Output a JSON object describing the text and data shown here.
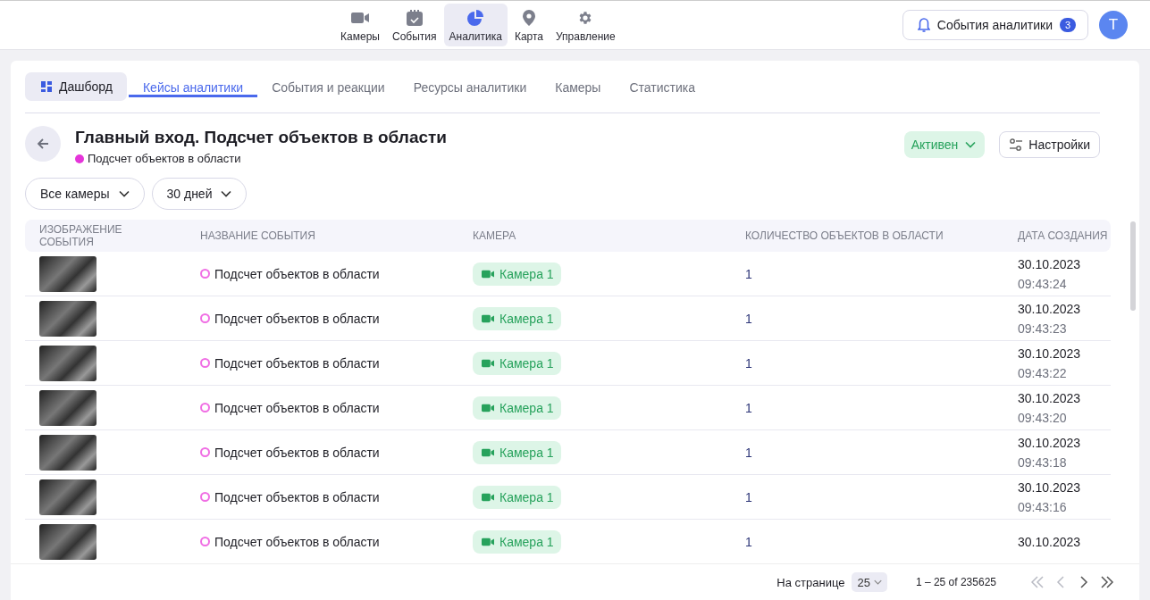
{
  "nav": {
    "items": [
      {
        "label": "Камеры",
        "kind": "camera",
        "selected": false
      },
      {
        "label": "События",
        "kind": "calendar",
        "selected": false
      },
      {
        "label": "Аналитика",
        "kind": "pie",
        "selected": true
      },
      {
        "label": "Карта",
        "kind": "pin",
        "selected": false
      },
      {
        "label": "Управление",
        "kind": "gear",
        "selected": false
      }
    ]
  },
  "notifications": {
    "label": "События аналитики",
    "count": "3"
  },
  "avatar": "T",
  "tabs": [
    {
      "label": "Дашборд",
      "kind": "button",
      "selected": false
    },
    {
      "label": "Кейсы аналитики",
      "kind": "tab",
      "selected": true
    },
    {
      "label": "События и реакции",
      "kind": "tab",
      "selected": false
    },
    {
      "label": "Ресурсы аналитики",
      "kind": "tab",
      "selected": false
    },
    {
      "label": "Камеры",
      "kind": "tab",
      "selected": false
    },
    {
      "label": "Статистика",
      "kind": "tab",
      "selected": false
    }
  ],
  "case": {
    "title": "Главный вход. Подсчет объектов в области",
    "subtitle": "Подсчет объектов в области",
    "color": "#e535d9",
    "status": "Активен",
    "settings": "Настройки"
  },
  "filters": [
    "Все камеры",
    "30 дней"
  ],
  "table": {
    "columns": [
      "ИЗОБРАЖЕНИЕ СОБЫТИЯ",
      "НАЗВАНИЕ СОБЫТИЯ",
      "КАМЕРА",
      "КОЛИЧЕСТВО ОБЪЕКТОВ В ОБЛАСТИ",
      "ДАТА СОЗДАНИЯ"
    ],
    "rows": [
      {
        "event": "Подсчет объектов в области",
        "camera": "Камера 1",
        "count": "1",
        "date": "30.10.2023",
        "time": "09:43:24"
      },
      {
        "event": "Подсчет объектов в области",
        "camera": "Камера 1",
        "count": "1",
        "date": "30.10.2023",
        "time": "09:43:23"
      },
      {
        "event": "Подсчет объектов в области",
        "camera": "Камера 1",
        "count": "1",
        "date": "30.10.2023",
        "time": "09:43:22"
      },
      {
        "event": "Подсчет объектов в области",
        "camera": "Камера 1",
        "count": "1",
        "date": "30.10.2023",
        "time": "09:43:20"
      },
      {
        "event": "Подсчет объектов в области",
        "camera": "Камера 1",
        "count": "1",
        "date": "30.10.2023",
        "time": "09:43:18"
      },
      {
        "event": "Подсчет объектов в области",
        "camera": "Камера 1",
        "count": "1",
        "date": "30.10.2023",
        "time": "09:43:16"
      },
      {
        "event": "Подсчет объектов в области",
        "camera": "Камера 1",
        "count": "1",
        "date": "30.10.2023"
      }
    ]
  },
  "pagination": {
    "label": "На странице",
    "page_size": "25",
    "range": "1 – 25 of 235625"
  }
}
